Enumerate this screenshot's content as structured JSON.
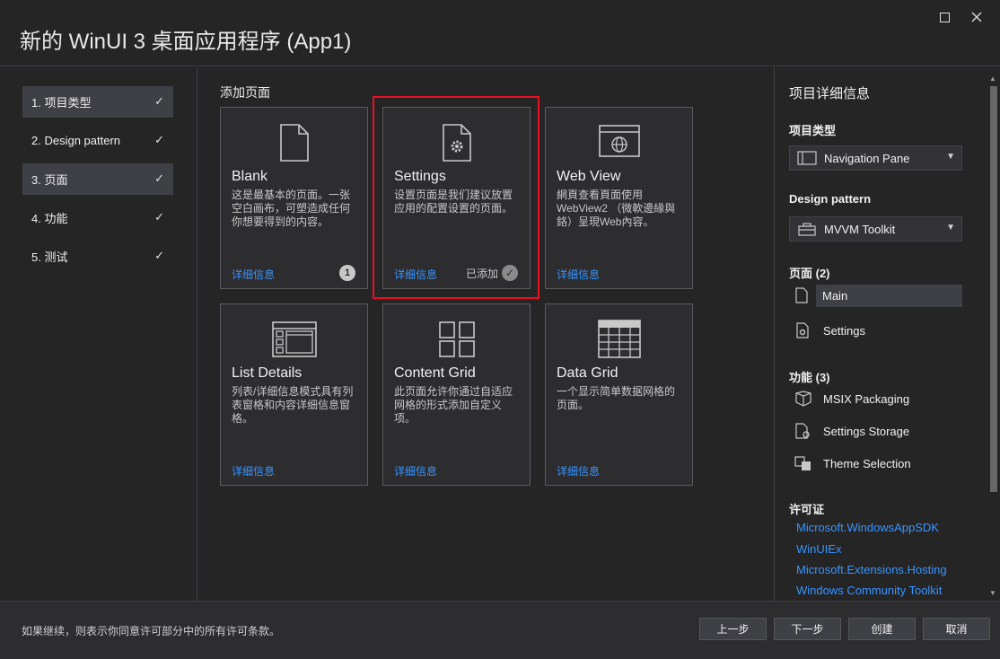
{
  "window": {
    "title": "新的 WinUI 3 桌面应用程序 (App1)"
  },
  "steps": [
    {
      "label": "1. 项目类型",
      "checked": true,
      "active": true
    },
    {
      "label": "2. Design pattern",
      "checked": true,
      "active": false
    },
    {
      "label": "3. 页面",
      "checked": true,
      "active": true
    },
    {
      "label": "4. 功能",
      "checked": true,
      "active": false
    },
    {
      "label": "5. 测试",
      "checked": true,
      "active": false
    }
  ],
  "check_glyph": "✓",
  "center": {
    "title": "添加页面",
    "cards": [
      {
        "name": "Blank",
        "desc": "这是最基本的页面。一张空白画布，可塑造成任何你想要得到的内容。",
        "more": "详细信息",
        "count": "1",
        "icon": "blank-page-icon"
      },
      {
        "name": "Settings",
        "desc": "设置页面是我们建议放置应用的配置设置的页面。",
        "more": "详细信息",
        "added": "已添加",
        "icon": "settings-page-icon"
      },
      {
        "name": "Web View",
        "desc": "網頁查看頁面使用 WebView2 （微軟邊緣與鉻）呈現Web內容。",
        "more": "详细信息",
        "icon": "web-view-icon"
      },
      {
        "name": "List Details",
        "desc": "列表/详细信息模式具有列表窗格和内容详细信息窗格。",
        "more": "详细信息",
        "icon": "list-details-icon"
      },
      {
        "name": "Content Grid",
        "desc": "此页面允许你通过自适应网格的形式添加自定义项。",
        "more": "详细信息",
        "icon": "content-grid-icon"
      },
      {
        "name": "Data Grid",
        "desc": "一个显示简单数据网格的页面。",
        "more": "详细信息",
        "icon": "data-grid-icon"
      }
    ]
  },
  "details": {
    "heading": "项目详细信息",
    "project_type_label": "项目类型",
    "project_type_value": "Navigation Pane",
    "design_pattern_label": "Design pattern",
    "design_pattern_value": "MVVM Toolkit",
    "pages_label": "页面 (2)",
    "pages": [
      "Main",
      "Settings"
    ],
    "features_label": "功能 (3)",
    "features": [
      "MSIX Packaging",
      "Settings Storage",
      "Theme Selection"
    ],
    "license_label": "许可证",
    "licenses": [
      "Microsoft.WindowsAppSDK",
      "WinUIEx",
      "Microsoft.Extensions.Hosting",
      "Windows Community Toolkit"
    ]
  },
  "footer": {
    "text": "如果继续，则表示你同意许可部分中的所有许可条款。",
    "back": "上一步",
    "next": "下一步",
    "create": "创建",
    "cancel": "取消"
  },
  "colors": {
    "link": "#3794ff",
    "highlight": "#e81123",
    "background": "#252526"
  }
}
